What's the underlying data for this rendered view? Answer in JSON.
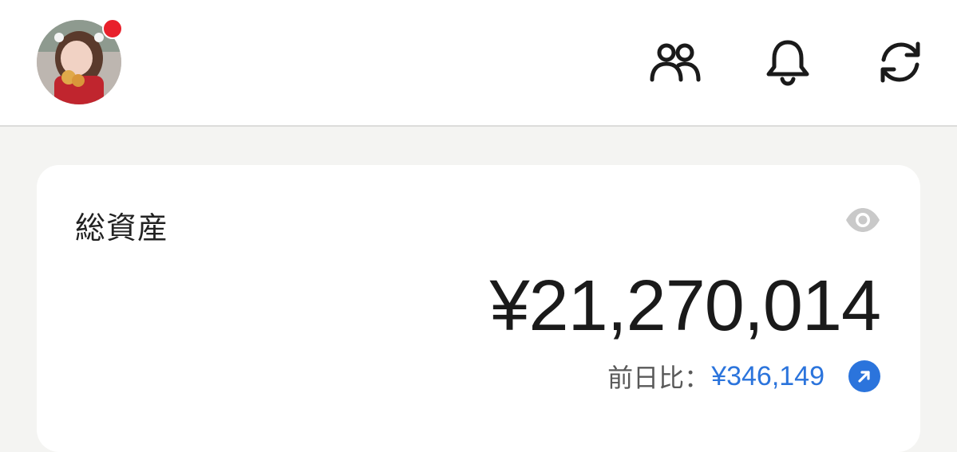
{
  "header": {
    "avatar_label": "user-avatar",
    "icons": [
      "friends-icon",
      "bell-icon",
      "refresh-icon"
    ],
    "notify_color": "#e8202b"
  },
  "card": {
    "title": "総資産",
    "total": "¥21,270,014",
    "diff_label": "前日比：",
    "diff_value": "¥346,149",
    "accent_color": "#2b74dc",
    "visibility_icon": "eye-icon",
    "arrow_icon": "arrow-up-right-icon"
  }
}
